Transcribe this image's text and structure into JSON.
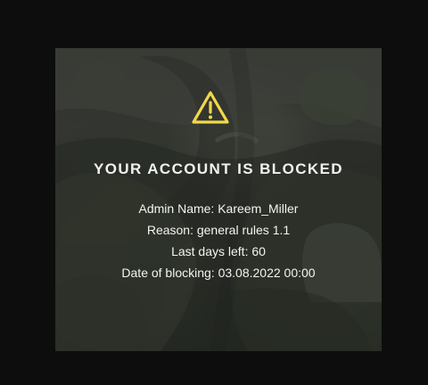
{
  "dialog": {
    "icon": "warning-icon",
    "title": "YOUR ACCOUNT IS BLOCKED",
    "lines": [
      "Admin Name: Kareem_Miller",
      "Reason: general rules 1.1",
      "Last days left: 60",
      "Date of blocking: 03.08.2022 00:00"
    ],
    "colors": {
      "warning": "#f2d84a",
      "text": "#f3f3f3"
    }
  }
}
